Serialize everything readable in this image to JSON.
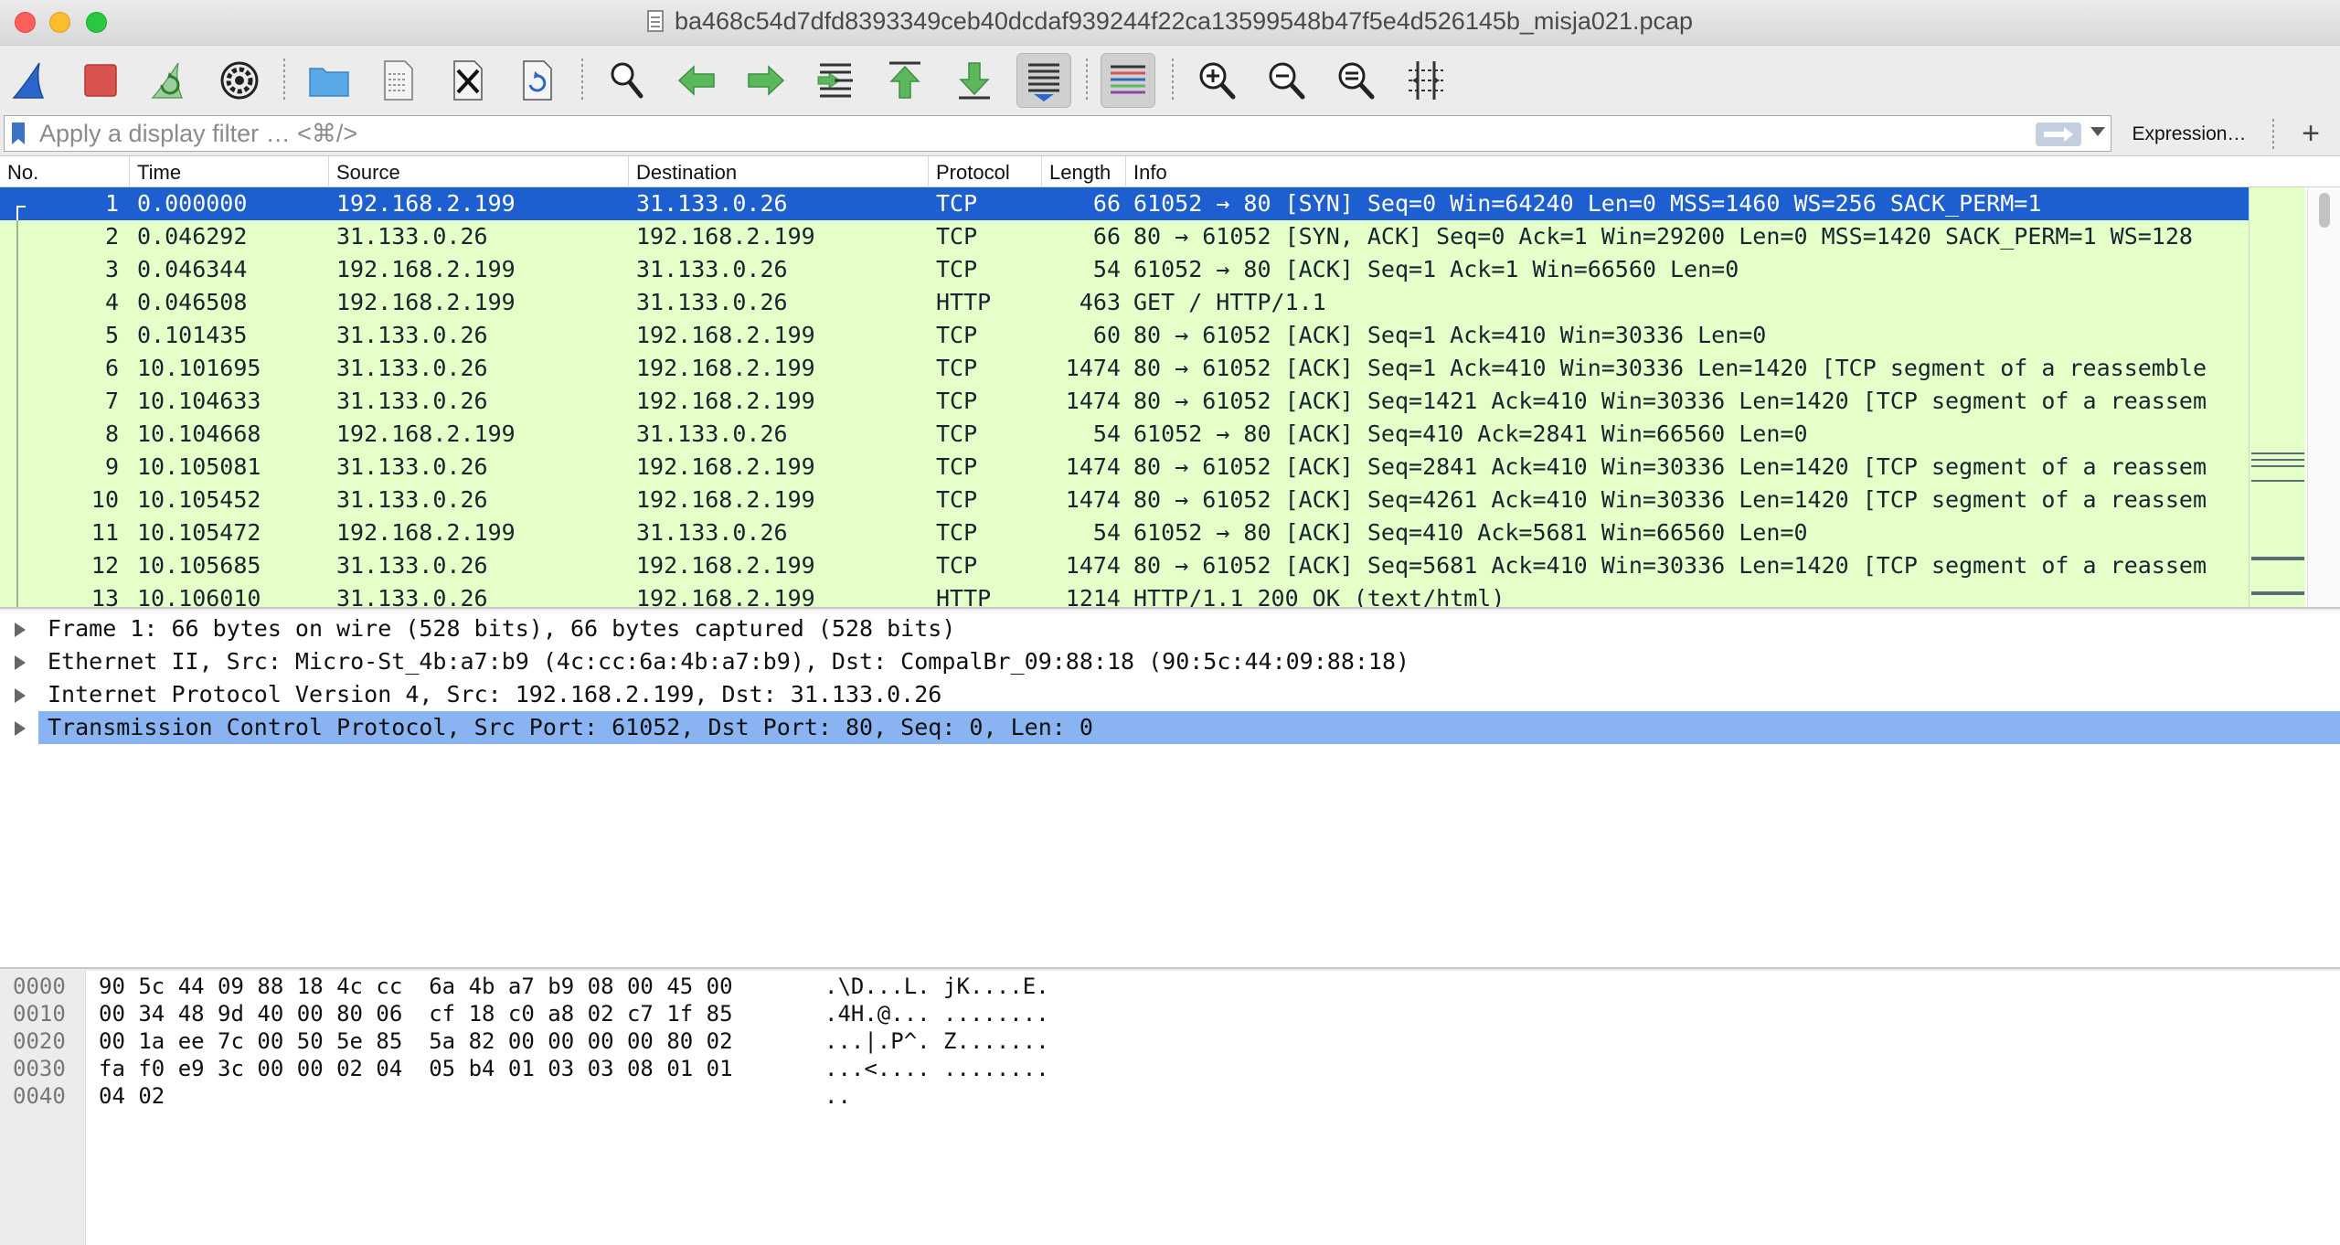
{
  "window": {
    "title": "ba468c54d7dfd8393349ceb40dcdaf939244f22ca13599548b47f5e4d526145b_misja021.pcap"
  },
  "toolbar": {
    "buttons": [
      "start-capture",
      "stop-capture",
      "restart-capture",
      "capture-options",
      "open-file",
      "save-file",
      "close-file",
      "reload-file",
      "find-packet",
      "go-back",
      "go-forward",
      "go-to-packet",
      "go-first",
      "go-last",
      "autoscroll",
      "colorize",
      "zoom-in",
      "zoom-out",
      "normal-size",
      "resize-columns"
    ]
  },
  "filter": {
    "placeholder": "Apply a display filter … <⌘/>",
    "value": "",
    "expression_label": "Expression…",
    "add_label": "+"
  },
  "packet_list": {
    "columns": [
      "No.",
      "Time",
      "Source",
      "Destination",
      "Protocol",
      "Length",
      "Info"
    ],
    "rows": [
      {
        "no": "1",
        "time": "0.000000",
        "src": "192.168.2.199",
        "dst": "31.133.0.26",
        "proto": "TCP",
        "len": "66",
        "info": "61052 → 80 [SYN] Seq=0 Win=64240 Len=0 MSS=1460 WS=256 SACK_PERM=1"
      },
      {
        "no": "2",
        "time": "0.046292",
        "src": "31.133.0.26",
        "dst": "192.168.2.199",
        "proto": "TCP",
        "len": "66",
        "info": "80 → 61052 [SYN, ACK] Seq=0 Ack=1 Win=29200 Len=0 MSS=1420 SACK_PERM=1 WS=128"
      },
      {
        "no": "3",
        "time": "0.046344",
        "src": "192.168.2.199",
        "dst": "31.133.0.26",
        "proto": "TCP",
        "len": "54",
        "info": "61052 → 80 [ACK] Seq=1 Ack=1 Win=66560 Len=0"
      },
      {
        "no": "4",
        "time": "0.046508",
        "src": "192.168.2.199",
        "dst": "31.133.0.26",
        "proto": "HTTP",
        "len": "463",
        "info": "GET / HTTP/1.1"
      },
      {
        "no": "5",
        "time": "0.101435",
        "src": "31.133.0.26",
        "dst": "192.168.2.199",
        "proto": "TCP",
        "len": "60",
        "info": "80 → 61052 [ACK] Seq=1 Ack=410 Win=30336 Len=0"
      },
      {
        "no": "6",
        "time": "10.101695",
        "src": "31.133.0.26",
        "dst": "192.168.2.199",
        "proto": "TCP",
        "len": "1474",
        "info": "80 → 61052 [ACK] Seq=1 Ack=410 Win=30336 Len=1420 [TCP segment of a reassemble"
      },
      {
        "no": "7",
        "time": "10.104633",
        "src": "31.133.0.26",
        "dst": "192.168.2.199",
        "proto": "TCP",
        "len": "1474",
        "info": "80 → 61052 [ACK] Seq=1421 Ack=410 Win=30336 Len=1420 [TCP segment of a reassem"
      },
      {
        "no": "8",
        "time": "10.104668",
        "src": "192.168.2.199",
        "dst": "31.133.0.26",
        "proto": "TCP",
        "len": "54",
        "info": "61052 → 80 [ACK] Seq=410 Ack=2841 Win=66560 Len=0"
      },
      {
        "no": "9",
        "time": "10.105081",
        "src": "31.133.0.26",
        "dst": "192.168.2.199",
        "proto": "TCP",
        "len": "1474",
        "info": "80 → 61052 [ACK] Seq=2841 Ack=410 Win=30336 Len=1420 [TCP segment of a reassem"
      },
      {
        "no": "10",
        "time": "10.105452",
        "src": "31.133.0.26",
        "dst": "192.168.2.199",
        "proto": "TCP",
        "len": "1474",
        "info": "80 → 61052 [ACK] Seq=4261 Ack=410 Win=30336 Len=1420 [TCP segment of a reassem"
      },
      {
        "no": "11",
        "time": "10.105472",
        "src": "192.168.2.199",
        "dst": "31.133.0.26",
        "proto": "TCP",
        "len": "54",
        "info": "61052 → 80 [ACK] Seq=410 Ack=5681 Win=66560 Len=0"
      },
      {
        "no": "12",
        "time": "10.105685",
        "src": "31.133.0.26",
        "dst": "192.168.2.199",
        "proto": "TCP",
        "len": "1474",
        "info": "80 → 61052 [ACK] Seq=5681 Ack=410 Win=30336 Len=1420 [TCP segment of a reassem"
      },
      {
        "no": "13",
        "time": "10.106010",
        "src": "31.133.0.26",
        "dst": "192.168.2.199",
        "proto": "HTTP",
        "len": "1214",
        "info": "HTTP/1.1 200 OK  (text/html)"
      }
    ],
    "selected_row": "1"
  },
  "details": {
    "rows": [
      "Frame 1: 66 bytes on wire (528 bits), 66 bytes captured (528 bits)",
      "Ethernet II, Src: Micro-St_4b:a7:b9 (4c:cc:6a:4b:a7:b9), Dst: CompalBr_09:88:18 (90:5c:44:09:88:18)",
      "Internet Protocol Version 4, Src: 192.168.2.199, Dst: 31.133.0.26",
      "Transmission Control Protocol, Src Port: 61052, Dst Port: 80, Seq: 0, Len: 0"
    ],
    "selected_index": 3
  },
  "bytes": {
    "rows": [
      {
        "offset": "0000",
        "hex": "90 5c 44 09 88 18 4c cc  6a 4b a7 b9 08 00 45 00",
        "ascii": ".\\D...L. jK....E."
      },
      {
        "offset": "0010",
        "hex": "00 34 48 9d 40 00 80 06  cf 18 c0 a8 02 c7 1f 85",
        "ascii": ".4H.@... ........"
      },
      {
        "offset": "0020",
        "hex": "00 1a ee 7c 00 50 5e 85  5a 82 00 00 00 00 80 02",
        "ascii": "...|.P^. Z......."
      },
      {
        "offset": "0030",
        "hex": "fa f0 e9 3c 00 00 02 04  05 b4 01 03 03 08 01 01",
        "ascii": "...<.... ........"
      },
      {
        "offset": "0040",
        "hex": "04 02",
        "ascii": ".."
      }
    ]
  },
  "colors": {
    "row_bg": "#e4ffc7",
    "selected_row_bg": "#1d5fd0",
    "detail_selected_bg": "#8ab4f1"
  }
}
